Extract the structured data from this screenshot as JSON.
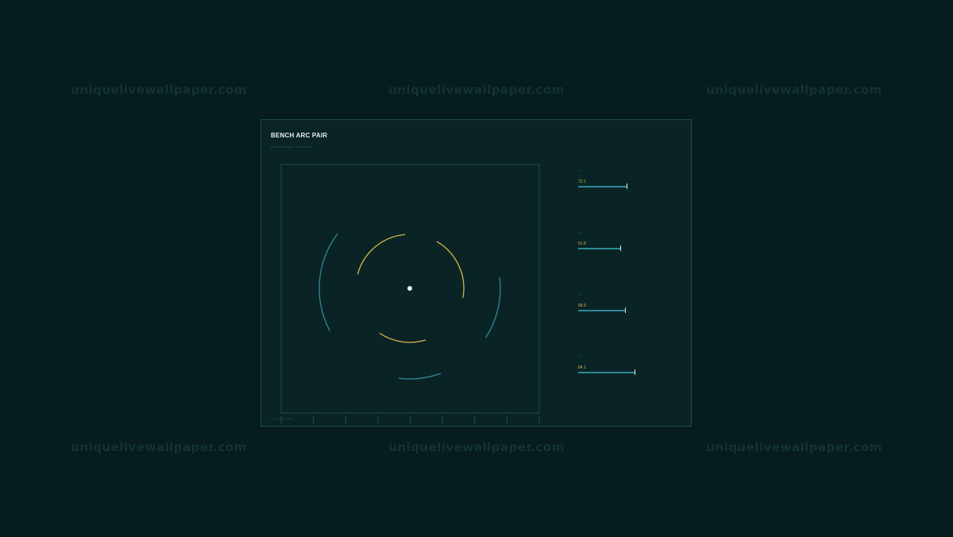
{
  "watermark": {
    "text": "uniquelivewallpaper.com"
  },
  "panel": {
    "title": "BENCH ARC PAIR",
    "subtitle": "paired arc layout, not to scale",
    "footer_note": "source: bench notes"
  },
  "bars": [
    {
      "label": "A1",
      "value_text": "72.1",
      "value": 72.1
    },
    {
      "label": "A2",
      "value_text": "61.8",
      "value": 61.8
    },
    {
      "label": "A3",
      "value_text": "68.9",
      "value": 68.9
    },
    {
      "label": "A4",
      "value_text": "84.1",
      "value": 84.1
    }
  ],
  "bar_scale_max": 100,
  "arc_plot": {
    "outer_arcs": [
      {
        "start_deg": -7,
        "end_deg": 33
      },
      {
        "start_deg": 70,
        "end_deg": 97
      },
      {
        "start_deg": 152,
        "end_deg": 217
      }
    ],
    "inner_arcs": [
      {
        "start_deg": -60,
        "end_deg": 10
      },
      {
        "start_deg": 73,
        "end_deg": 124
      },
      {
        "start_deg": 195,
        "end_deg": 265
      }
    ],
    "axis_ticks": 9
  },
  "colors": {
    "background": "#061c1d",
    "panel": "#0a2426",
    "panel_border": "#1b4a4f",
    "outer_arc": "#2e8a95",
    "inner_arc": "#d9b54a",
    "center_dot": "#e7f1f1",
    "bar": "#2e8a95"
  }
}
